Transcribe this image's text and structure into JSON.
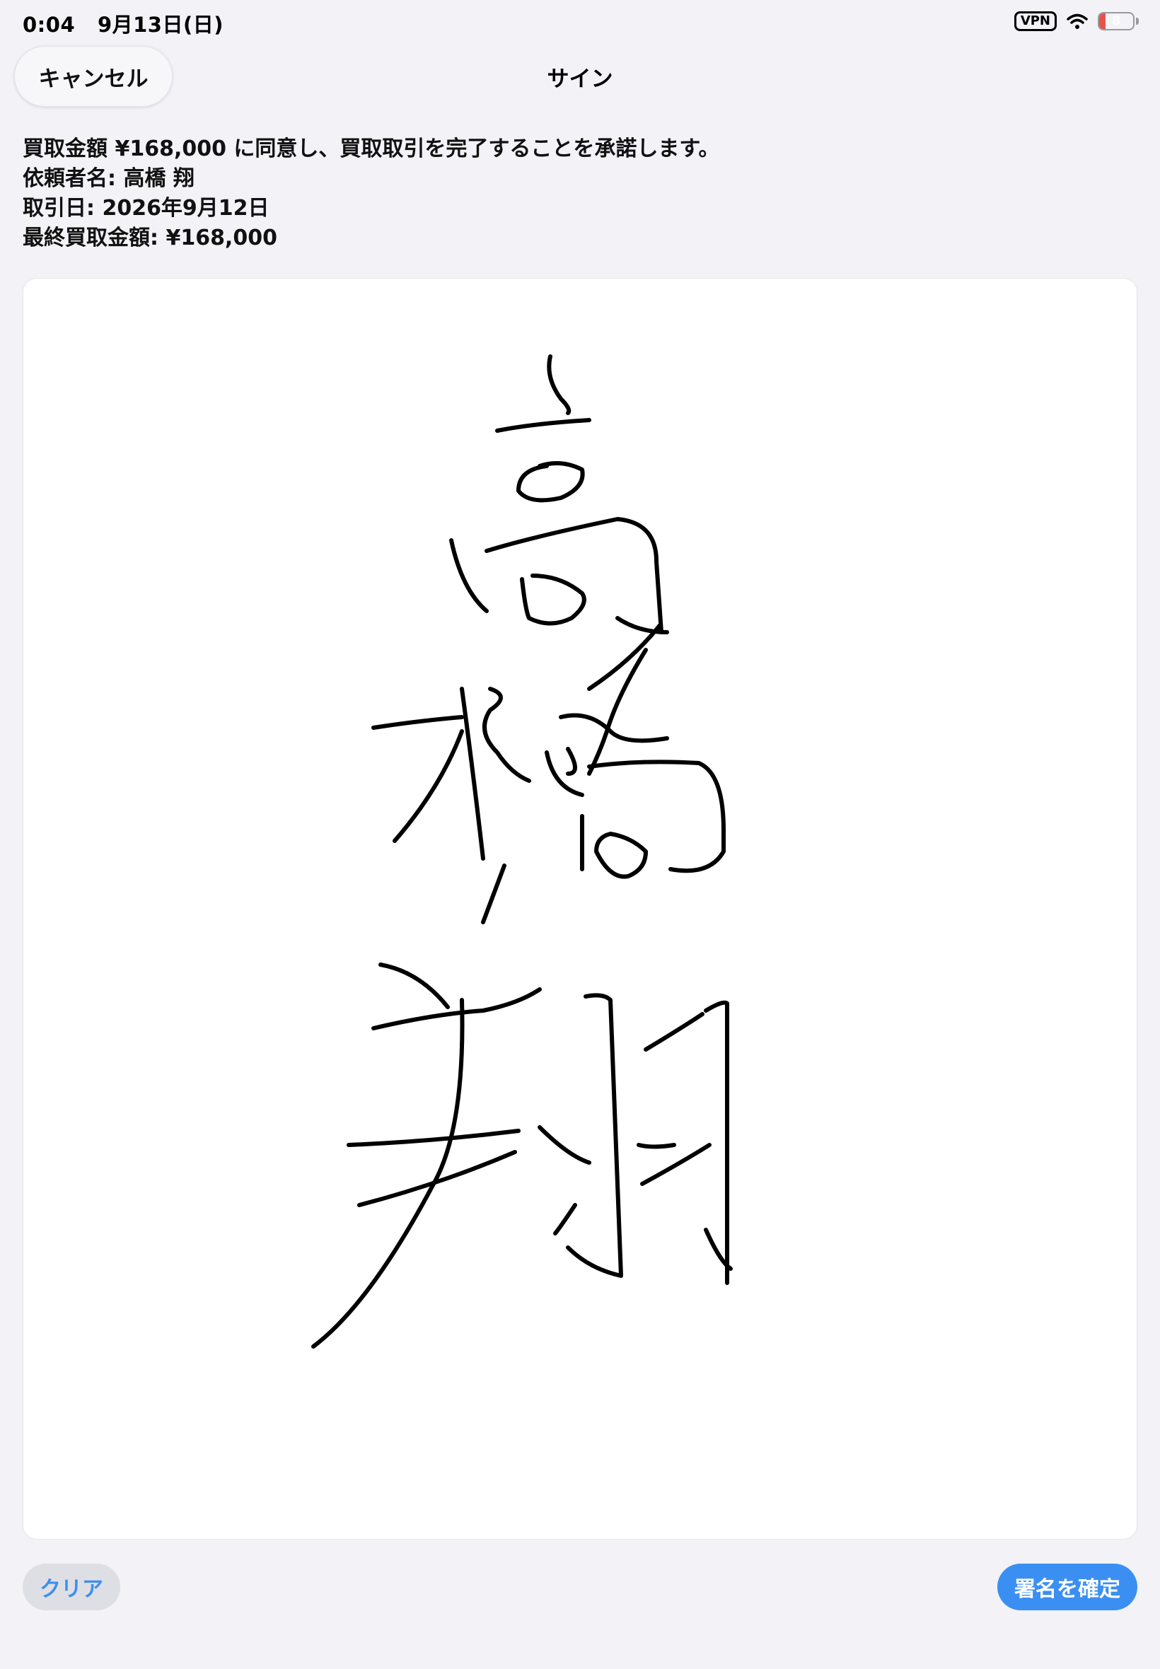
{
  "status_bar": {
    "time": "0:04",
    "date": "9月13日(日)",
    "vpn_label": "VPN",
    "battery_level": "8",
    "battery_percent": 8,
    "battery_color": "#e8524a",
    "icons": [
      "vpn-icon",
      "wifi-icon",
      "battery-icon"
    ]
  },
  "header": {
    "cancel_label": "キャンセル",
    "title": "サイン"
  },
  "consent": {
    "line1": "買取金額 ¥168,000 に同意し、買取取引を完了することを承諾します。",
    "line2": "依頼者名: 高橋 翔",
    "line3": "取引日: 2026年9月12日",
    "line4": "最終買取金額: ¥168,000"
  },
  "signature": {
    "signed_name": "高橋 翔",
    "ink_color": "#000000"
  },
  "footer": {
    "clear_label": "クリア",
    "confirm_label": "署名を確定"
  },
  "colors": {
    "background": "#f2f2f7",
    "accent": "#3b8ff2",
    "secondary_button": "#dedfe4"
  }
}
